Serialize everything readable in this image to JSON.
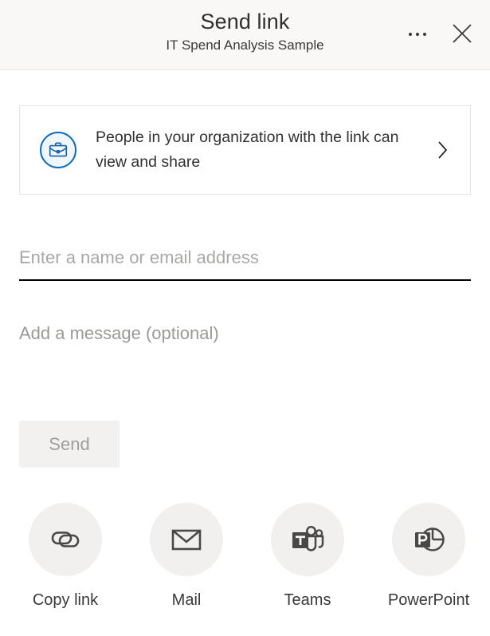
{
  "header": {
    "title": "Send link",
    "subtitle": "IT Spend Analysis Sample",
    "more_options_label": "More options",
    "close_label": "Close"
  },
  "permission": {
    "text": "People in your organization with the link can view and share",
    "icon": "briefcase-icon",
    "chevron": "chevron-right-icon",
    "accent_color": "#0f6cbd",
    "icon_fill": "#eff6fc"
  },
  "recipients": {
    "value": "",
    "placeholder": "Enter a name or email address"
  },
  "message": {
    "value": "",
    "placeholder": "Add a message (optional)"
  },
  "send": {
    "label": "Send",
    "disabled": true
  },
  "actions": [
    {
      "label": "Copy link",
      "icon": "link-icon"
    },
    {
      "label": "Mail",
      "icon": "envelope-icon"
    },
    {
      "label": "Teams",
      "icon": "teams-icon"
    },
    {
      "label": "PowerPoint",
      "icon": "powerpoint-icon"
    }
  ]
}
